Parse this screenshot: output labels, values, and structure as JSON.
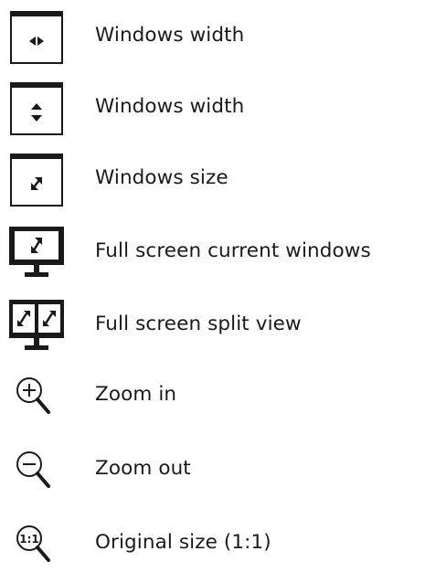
{
  "items": [
    {
      "icon": "window-width-horizontal-icon",
      "label": "Windows width"
    },
    {
      "icon": "window-width-vertical-icon",
      "label": "Windows width"
    },
    {
      "icon": "window-size-icon",
      "label": "Windows size"
    },
    {
      "icon": "full-screen-current-window-icon",
      "label": "Full screen current windows"
    },
    {
      "icon": "full-screen-split-view-icon",
      "label": "Full screen split view"
    },
    {
      "icon": "zoom-in-icon",
      "label": "Zoom in"
    },
    {
      "icon": "zoom-out-icon",
      "label": "Zoom out"
    },
    {
      "icon": "original-size-icon",
      "label": "Original size (1:1)",
      "icon_text": "1:1"
    }
  ],
  "colors": {
    "icon_fill": "#1a1a1a",
    "text": "#1a1a1a",
    "background": "#ffffff"
  }
}
